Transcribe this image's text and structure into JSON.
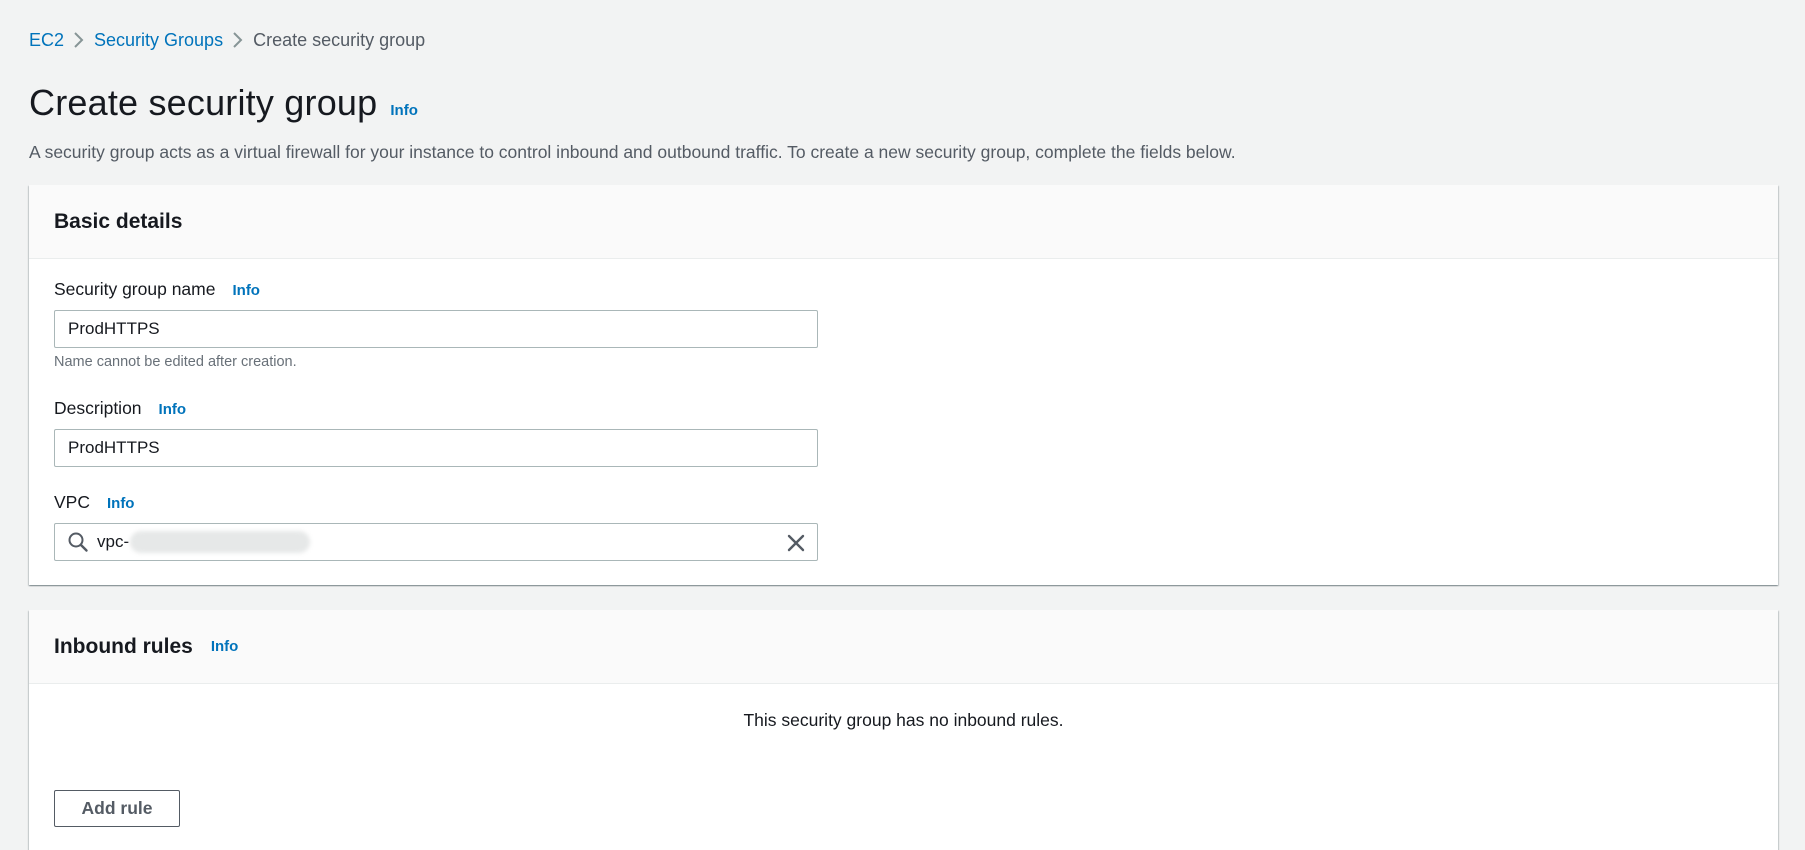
{
  "breadcrumb": {
    "items": [
      "EC2",
      "Security Groups"
    ],
    "current": "Create security group"
  },
  "page": {
    "title": "Create security group",
    "info_label": "Info",
    "description": "A security group acts as a virtual firewall for your instance to control inbound and outbound traffic. To create a new security group, complete the fields below."
  },
  "basic_details": {
    "title": "Basic details",
    "name_field": {
      "label": "Security group name",
      "info_label": "Info",
      "value": "ProdHTTPS",
      "hint": "Name cannot be edited after creation."
    },
    "description_field": {
      "label": "Description",
      "info_label": "Info",
      "value": "ProdHTTPS"
    },
    "vpc_field": {
      "label": "VPC",
      "info_label": "Info",
      "value": "vpc-"
    }
  },
  "inbound_rules": {
    "title": "Inbound rules",
    "info_label": "Info",
    "empty_message": "This security group has no inbound rules.",
    "add_rule_label": "Add rule"
  },
  "icons": {
    "breadcrumb_separator": "chevron-right-icon",
    "vpc_search": "search-icon",
    "vpc_clear": "close-icon"
  },
  "colors": {
    "link": "#0073bb",
    "background": "#f2f3f3",
    "panel_header": "#fafafa",
    "text": "#16191f",
    "secondary_text": "#545b64"
  }
}
